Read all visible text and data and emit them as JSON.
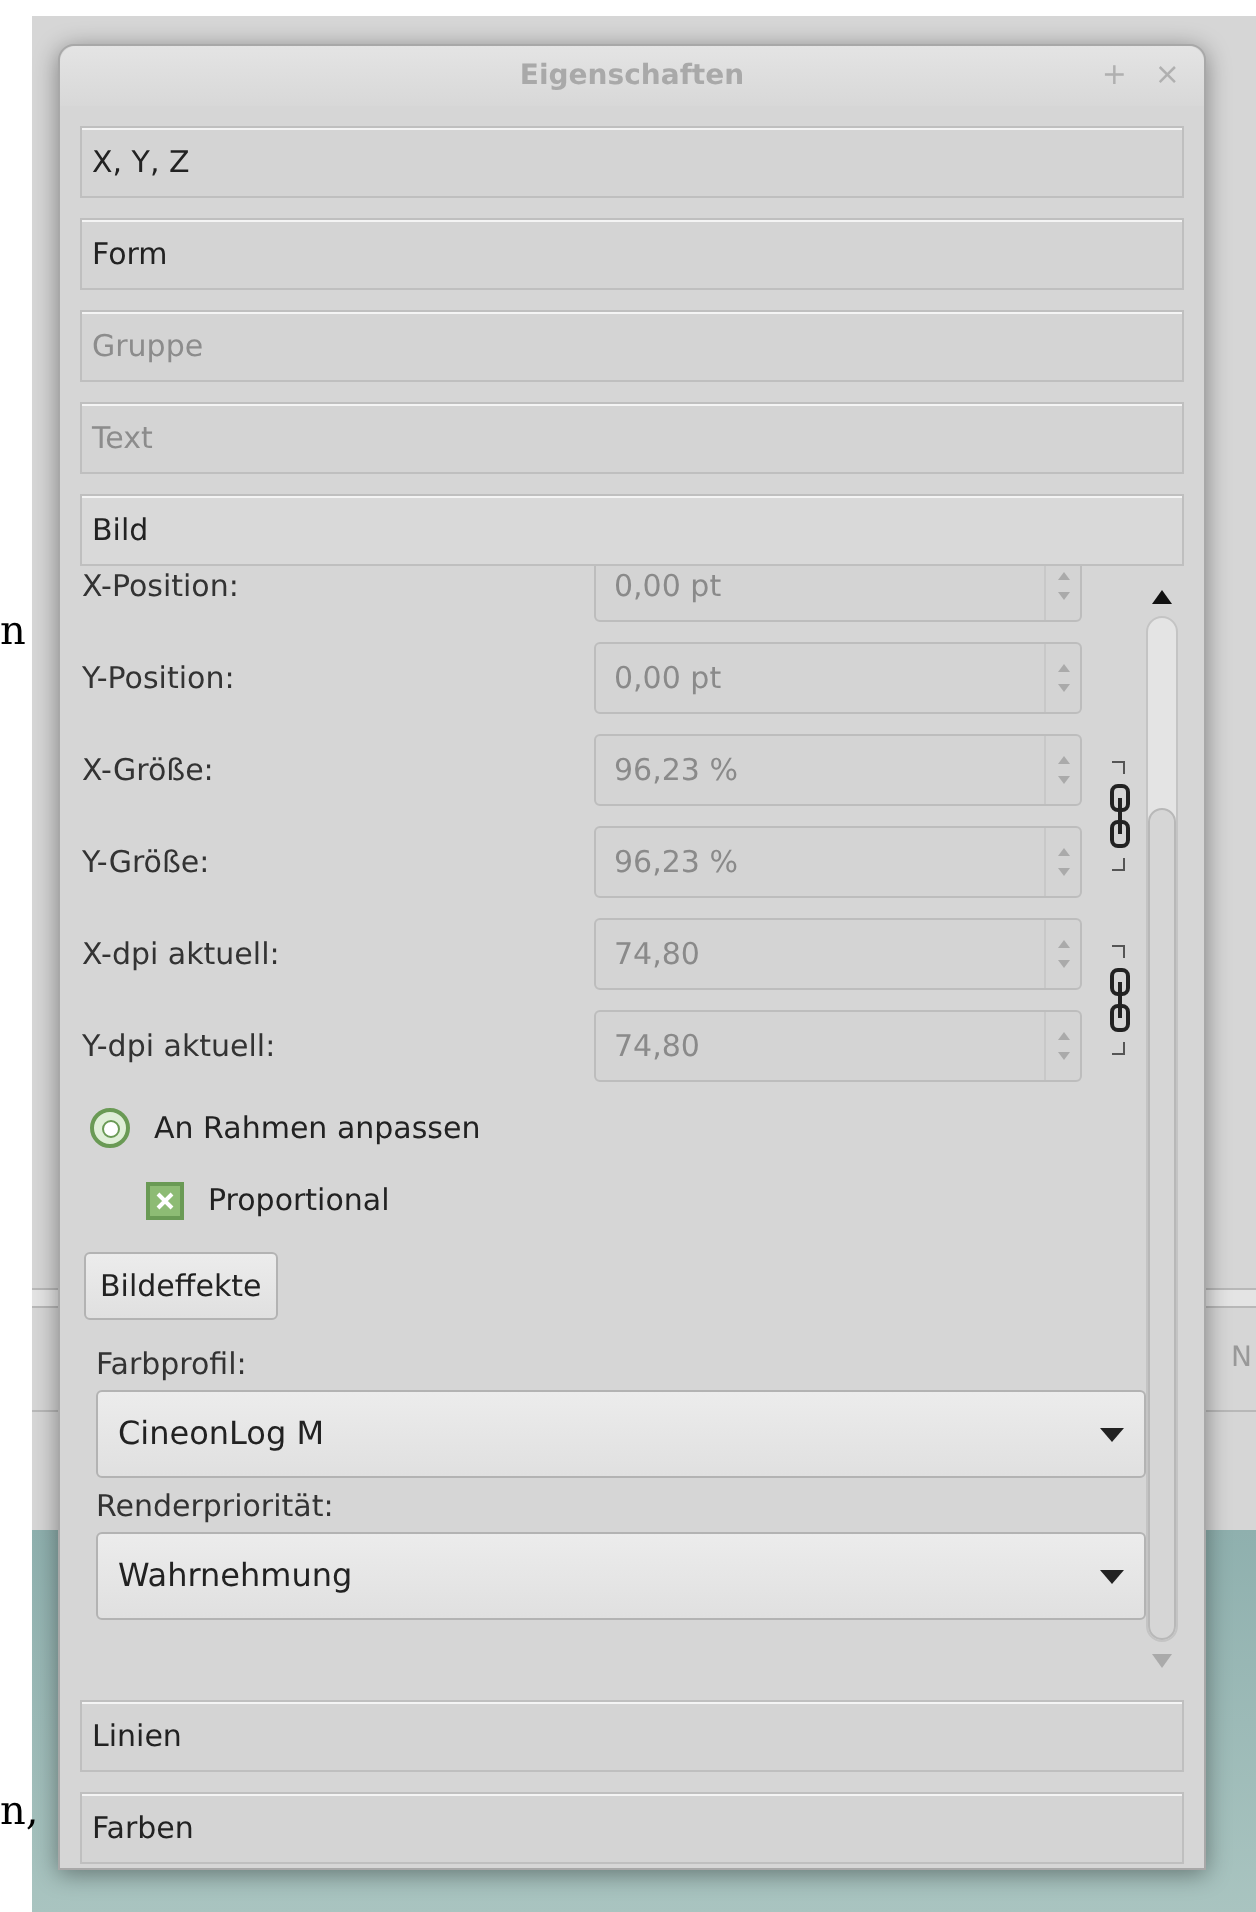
{
  "background": {
    "page_text_top": "n",
    "page_text_bottom": "n,",
    "behind_text": "N"
  },
  "window": {
    "title": "Eigenschaften",
    "buttons": [
      "+",
      "×"
    ]
  },
  "sections": [
    {
      "label": "X, Y, Z",
      "disabled": false,
      "expanded": false
    },
    {
      "label": "Form",
      "disabled": false,
      "expanded": false
    },
    {
      "label": "Gruppe",
      "disabled": true,
      "expanded": false
    },
    {
      "label": "Text",
      "disabled": true,
      "expanded": false
    },
    {
      "label": "Bild",
      "disabled": false,
      "expanded": true
    },
    {
      "label": "Linien",
      "disabled": false,
      "expanded": false
    },
    {
      "label": "Farben",
      "disabled": false,
      "expanded": false
    }
  ],
  "image_panel": {
    "fields": [
      {
        "label": "X-Position:",
        "value": "0,00 pt",
        "disabled": true
      },
      {
        "label": "Y-Position:",
        "value": "0,00 pt",
        "disabled": true
      },
      {
        "label": "X-Größe:",
        "value": "96,23 %",
        "disabled": true
      },
      {
        "label": "Y-Größe:",
        "value": "96,23 %",
        "disabled": true
      },
      {
        "label": "X-dpi aktuell:",
        "value": "74,80",
        "disabled": true
      },
      {
        "label": "Y-dpi aktuell:",
        "value": "74,80",
        "disabled": true
      }
    ],
    "fit_frame": {
      "label": "An Rahmen anpassen",
      "selected": true
    },
    "proportional": {
      "label": "Proportional",
      "checked": true
    },
    "effects_button": "Bildeffekte",
    "color_profile": {
      "label": "Farbprofil:",
      "value": "CineonLog M"
    },
    "render_intent": {
      "label": "Renderpriorität:",
      "value": "Wahrnehmung"
    }
  }
}
